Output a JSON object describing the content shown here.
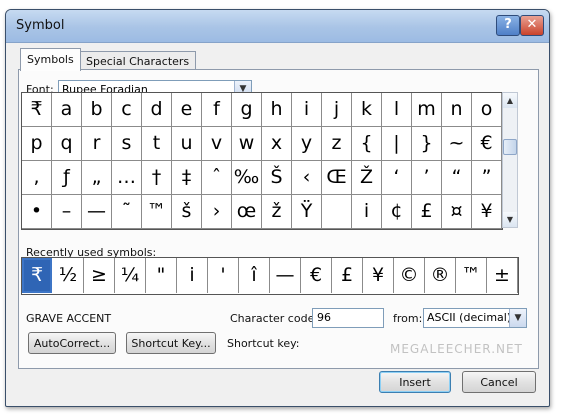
{
  "window": {
    "title": "Symbol",
    "help_label": "?",
    "close_label": "✕"
  },
  "tabs": [
    {
      "label": "Symbols",
      "selected": true
    },
    {
      "label": "Special Characters",
      "selected": false
    }
  ],
  "font": {
    "label": "Font:",
    "value": "Rupee Foradian"
  },
  "symbol_grid": {
    "rows": [
      [
        "₹",
        "a",
        "b",
        "c",
        "d",
        "e",
        "f",
        "g",
        "h",
        "i",
        "j",
        "k",
        "l",
        "m",
        "n",
        "o"
      ],
      [
        "p",
        "q",
        "r",
        "s",
        "t",
        "u",
        "v",
        "w",
        "x",
        "y",
        "z",
        "{",
        "|",
        "}",
        "~",
        "€"
      ],
      [
        ",",
        "ƒ",
        "„",
        "…",
        "†",
        "‡",
        "ˆ",
        "‰",
        "Š",
        "‹",
        "Œ",
        "Ž",
        "‘",
        "’",
        "“",
        "”"
      ],
      [
        "•",
        "–",
        "—",
        "˜",
        "™",
        "š",
        "›",
        "œ",
        "ž",
        "Ÿ",
        "",
        "i",
        "¢",
        "£",
        "¤",
        "¥"
      ]
    ]
  },
  "recently_used": {
    "label": "Recently used symbols:",
    "symbols": [
      "₹",
      "½",
      "≥",
      "¼",
      "\"",
      "i",
      "'",
      "î",
      "—",
      "€",
      "£",
      "¥",
      "©",
      "®",
      "™",
      "±"
    ]
  },
  "char_name": "GRAVE ACCENT",
  "char_code": {
    "label": "Character code:",
    "value": "96"
  },
  "from": {
    "label": "from:",
    "value": "ASCII (decimal)"
  },
  "buttons": {
    "autocorrect": "AutoCorrect...",
    "shortcut_key": "Shortcut Key...",
    "insert": "Insert",
    "cancel": "Cancel"
  },
  "shortcut_key_label": "Shortcut key:",
  "watermark": "MEGALEECHER.NET",
  "colors": {
    "selection": "#2f65b5",
    "titlebar": "#a9c4e6",
    "close_button": "#c9422b"
  }
}
